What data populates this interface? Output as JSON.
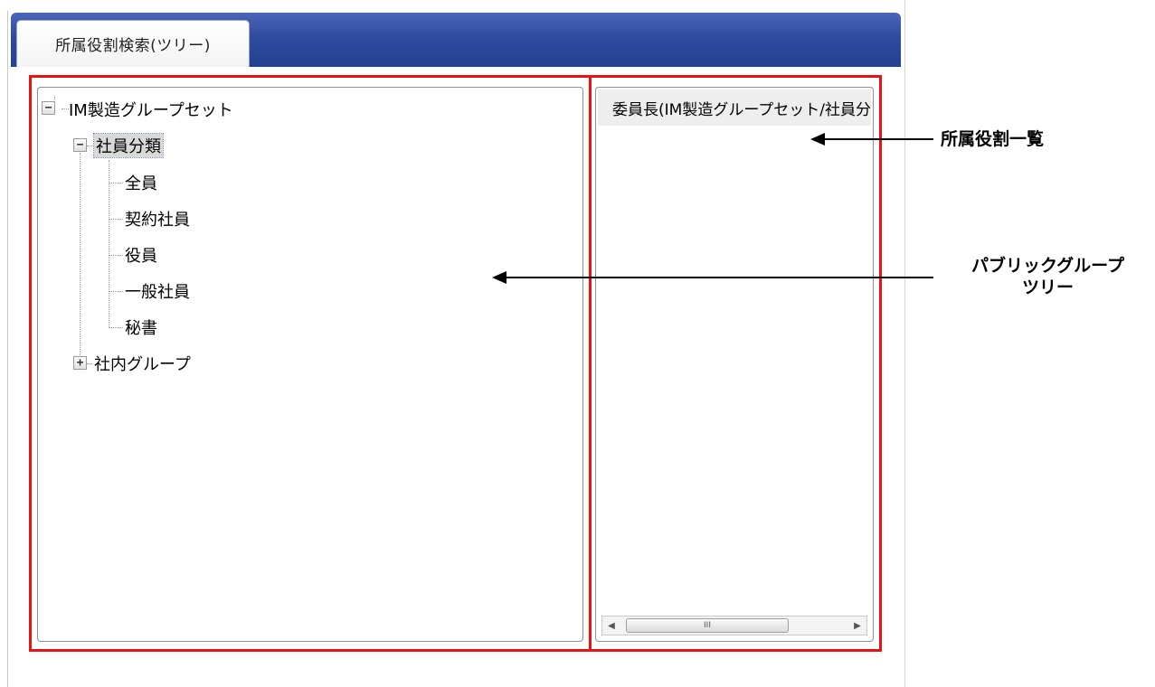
{
  "tab": {
    "label": "所属役割検索(ツリー)"
  },
  "tree": {
    "root": {
      "label": "IM製造グループセット",
      "toggle": "−"
    },
    "category": {
      "label": "社員分類",
      "toggle": "−"
    },
    "children": [
      "全員",
      "契約社員",
      "役員",
      "一般社員",
      "秘書"
    ],
    "collapsed_group": {
      "label": "社内グループ",
      "toggle": "+"
    }
  },
  "list": {
    "items": [
      "委員長(IM製造グループセット/社員分類)"
    ],
    "scroll_thumb_grip": "III"
  },
  "annotations": {
    "role_list": "所属役割一覧",
    "tree_line1": "パブリックグループ",
    "tree_line2": "ツリー"
  },
  "colors": {
    "highlight": "#ee1111",
    "tab_bar": "#2f4b9f"
  }
}
